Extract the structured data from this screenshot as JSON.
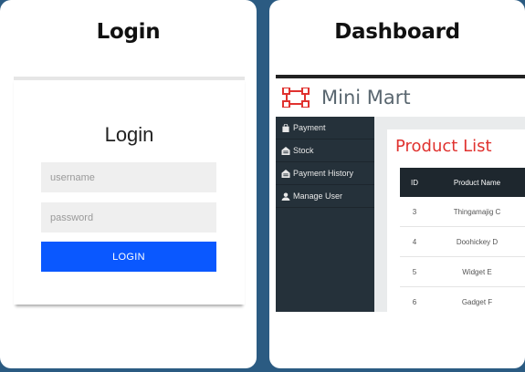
{
  "cards": [
    {
      "title": "Login"
    },
    {
      "title": "Dashboard"
    }
  ],
  "login": {
    "heading": "Login",
    "username_placeholder": "username",
    "password_placeholder": "password",
    "button_label": "LOGIN",
    "button_color": "#0a58ff"
  },
  "dashboard": {
    "app_title": "Mini Mart",
    "logo_icon": "network-nodes-icon",
    "sidebar": {
      "items": [
        {
          "label": "Payment",
          "icon": "bag-icon"
        },
        {
          "label": "Stock",
          "icon": "warehouse-icon"
        },
        {
          "label": "Payment History",
          "icon": "warehouse-icon"
        },
        {
          "label": "Manage User",
          "icon": "user-icon"
        }
      ]
    },
    "main": {
      "title": "Product List",
      "title_color": "#e0322f",
      "table": {
        "headers": [
          "ID",
          "Product Name"
        ],
        "rows": [
          [
            "3",
            "Thingamajig C"
          ],
          [
            "4",
            "Doohickey D"
          ],
          [
            "5",
            "Widget E"
          ],
          [
            "6",
            "Gadget F"
          ]
        ]
      }
    }
  }
}
